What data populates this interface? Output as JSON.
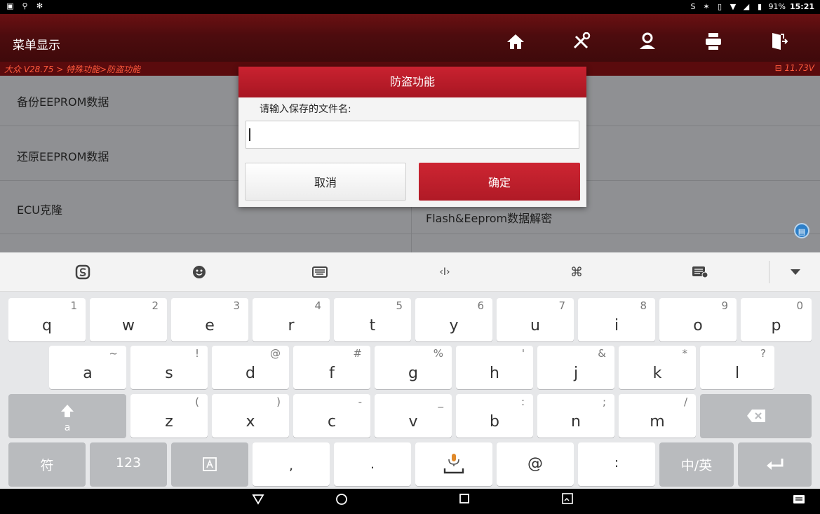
{
  "status_bar": {
    "left_icons": [
      "image-icon",
      "usb-icon",
      "bluetooth-icon"
    ],
    "battery": "91%",
    "time": "15:21"
  },
  "header": {
    "title": "菜单显示",
    "buttons": [
      "home-icon",
      "diagnose-tools-icon",
      "user-icon",
      "print-icon",
      "exit-icon"
    ]
  },
  "breadcrumb": {
    "path": "大众 V28.75 > 特殊功能>防盗功能",
    "voltage": "11.73V"
  },
  "menu": {
    "items_left": [
      "备份EEPROM数据",
      "还原EEPROM数据",
      "ECU克隆"
    ],
    "items_right_visible": [
      "Flash&Eeprom数据解密"
    ]
  },
  "dialog": {
    "title": "防盗功能",
    "prompt": "请输入保存的文件名:",
    "input_value": "",
    "cancel_label": "取消",
    "ok_label": "确定"
  },
  "keyboard": {
    "toolbar": [
      "sogou-logo-icon",
      "emoji-icon",
      "keyboard-icon",
      "cursor-move-icon",
      "command-icon",
      "clipboard-icon",
      "collapse-icon"
    ],
    "row1": [
      {
        "k": "q",
        "h": "1"
      },
      {
        "k": "w",
        "h": "2"
      },
      {
        "k": "e",
        "h": "3"
      },
      {
        "k": "r",
        "h": "4"
      },
      {
        "k": "t",
        "h": "5"
      },
      {
        "k": "y",
        "h": "6"
      },
      {
        "k": "u",
        "h": "7"
      },
      {
        "k": "i",
        "h": "8"
      },
      {
        "k": "o",
        "h": "9"
      },
      {
        "k": "p",
        "h": "0"
      }
    ],
    "row2": [
      {
        "k": "a",
        "h": "~"
      },
      {
        "k": "s",
        "h": "!"
      },
      {
        "k": "d",
        "h": "@"
      },
      {
        "k": "f",
        "h": "#"
      },
      {
        "k": "g",
        "h": "%"
      },
      {
        "k": "h",
        "h": "'"
      },
      {
        "k": "j",
        "h": "&"
      },
      {
        "k": "k",
        "h": "*"
      },
      {
        "k": "l",
        "h": "?"
      }
    ],
    "row3": [
      {
        "k": "z",
        "h": "("
      },
      {
        "k": "x",
        "h": ")"
      },
      {
        "k": "c",
        "h": "-"
      },
      {
        "k": "v",
        "h": "_"
      },
      {
        "k": "b",
        "h": ":"
      },
      {
        "k": "n",
        "h": ";"
      },
      {
        "k": "m",
        "h": "/"
      }
    ],
    "shift_sub": "a",
    "row4": {
      "symbols": "符",
      "numbers": "123",
      "comma": ",",
      "period": ".",
      "at": "@",
      "colon": ":",
      "lang": "中/英"
    }
  }
}
